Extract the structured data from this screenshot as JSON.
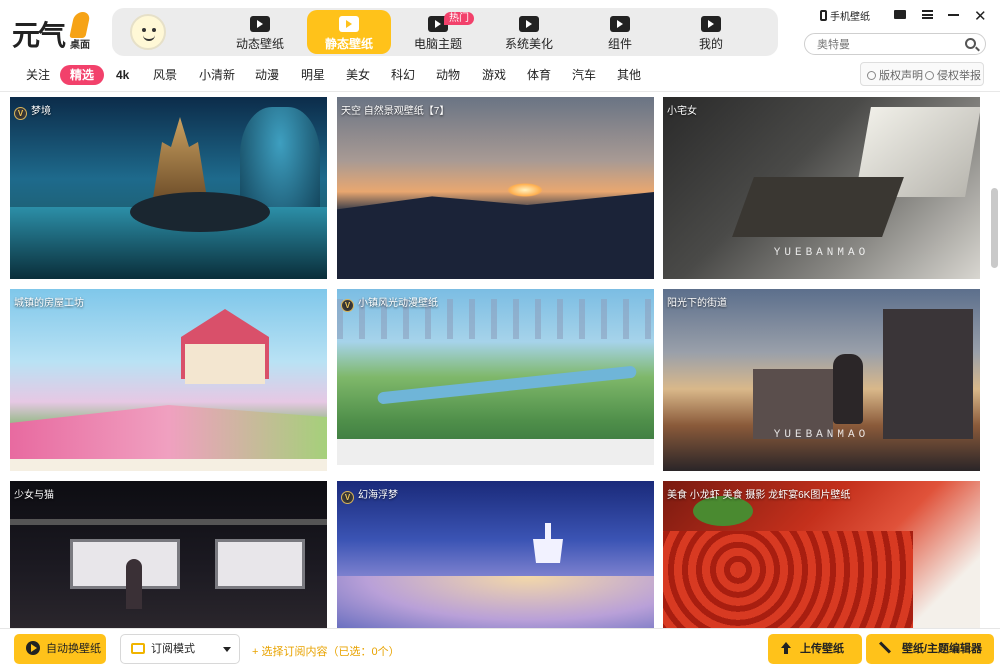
{
  "app": {
    "logo_text": "元气",
    "logo_sub": "桌面"
  },
  "nav": {
    "tabs": [
      {
        "label": "动态壁纸"
      },
      {
        "label": "静态壁纸"
      },
      {
        "label": "电脑主题",
        "badge": "热门"
      },
      {
        "label": "系统美化"
      },
      {
        "label": "组件"
      },
      {
        "label": "我的"
      }
    ],
    "active_index": 1
  },
  "system": {
    "phone_wallpaper": "手机壁纸"
  },
  "search": {
    "placeholder": "奥特曼"
  },
  "categories": [
    "关注",
    "精选",
    "4k",
    "风景",
    "小清新",
    "动漫",
    "明星",
    "美女",
    "科幻",
    "动物",
    "游戏",
    "体育",
    "汽车",
    "其他"
  ],
  "category_active_index": 1,
  "links": {
    "copyright": "版权声明",
    "report": "侵权举报"
  },
  "cards": [
    {
      "title": "梦境",
      "vip": true
    },
    {
      "title": "天空 自然景观壁纸【7】",
      "vip": false
    },
    {
      "title": "小宅女",
      "vip": false,
      "watermark": "YUEBANMAO"
    },
    {
      "title": "城镇的房屋工坊",
      "vip": false
    },
    {
      "title": "小镇风光动漫壁纸",
      "vip": true
    },
    {
      "title": "阳光下的街道",
      "vip": false,
      "watermark": "YUEBANMAO"
    },
    {
      "title": "少女与猫",
      "vip": false
    },
    {
      "title": "幻海浮梦",
      "vip": true
    },
    {
      "title": "美食 小龙虾 美食 摄影 龙虾宴6K图片壁纸",
      "vip": false
    }
  ],
  "vip_mark": "V",
  "bottom": {
    "auto_change": "自动换壁纸",
    "mode": "订阅模式",
    "subscribe_hint": "+ 选择订阅内容（已选：0个）",
    "upload": "上传壁纸",
    "editor": "壁纸/主题编辑器"
  },
  "colors": {
    "accent_yellow": "#ffc21a",
    "accent_pink": "#f2416b"
  }
}
